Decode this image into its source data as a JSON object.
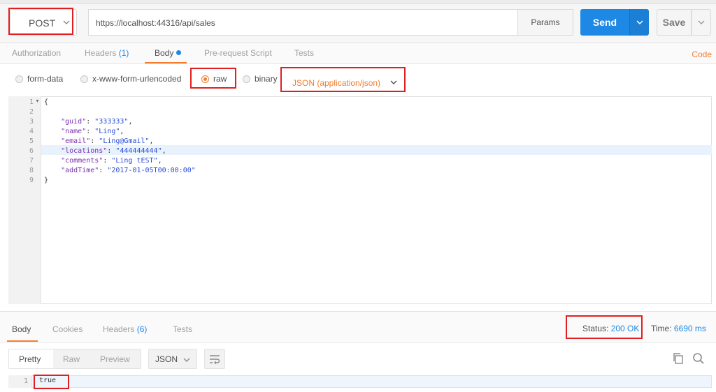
{
  "request": {
    "method": "POST",
    "url": "https://localhost:44316/api/sales",
    "params_label": "Params",
    "send_label": "Send",
    "save_label": "Save"
  },
  "request_tabs": {
    "authorization": "Authorization",
    "headers": "Headers",
    "headers_count": "(1)",
    "body": "Body",
    "prerequest": "Pre-request Script",
    "tests": "Tests",
    "code": "Code"
  },
  "body_modes": {
    "form_data": "form-data",
    "urlencoded": "x-www-form-urlencoded",
    "raw": "raw",
    "binary": "binary",
    "selected": "raw",
    "content_type": "JSON (application/json)"
  },
  "editor": {
    "line_numbers": [
      "1",
      "2",
      "3",
      "4",
      "5",
      "6",
      "7",
      "8",
      "9"
    ],
    "open_brace": "{",
    "close_brace": "}",
    "fields": [
      {
        "key": "\"guid\"",
        "value": "\"333333\"",
        "trail": ","
      },
      {
        "key": "\"name\"",
        "value": "\"Ling\"",
        "trail": ","
      },
      {
        "key": "\"email\"",
        "value": "\"Ling@Gmail\"",
        "trail": ","
      },
      {
        "key": "\"locations\"",
        "value": "\"444444444\"",
        "trail": ","
      },
      {
        "key": "\"comments\"",
        "value": "\"Ling tEST\"",
        "trail": ","
      },
      {
        "key": "\"addTime\"",
        "value": "\"2017-01-05T00:00:00\"",
        "trail": ""
      }
    ]
  },
  "response_tabs": {
    "body": "Body",
    "cookies": "Cookies",
    "headers": "Headers",
    "headers_count": "(6)",
    "tests": "Tests"
  },
  "response_meta": {
    "status_label": "Status:",
    "status_value": "200 OK",
    "time_label": "Time:",
    "time_value": "6690 ms"
  },
  "response_view": {
    "pretty": "Pretty",
    "raw": "Raw",
    "preview": "Preview",
    "format": "JSON",
    "line_number": "1",
    "body_text": "true"
  },
  "colors": {
    "accent_orange": "#f57c2c",
    "send_blue": "#1e88e5",
    "highlight_red": "#e02020"
  }
}
